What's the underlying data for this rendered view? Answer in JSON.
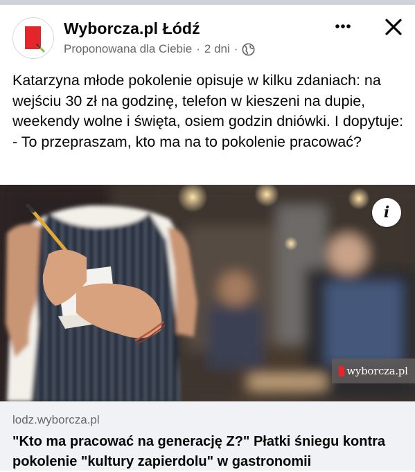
{
  "post": {
    "page_name": "Wyborcza.pl Łódź",
    "subtitle": "Proponowana dla Ciebie",
    "time": "2 dni",
    "separator": "·",
    "audience_icon": "globe-icon",
    "text": "Katarzyna młode pokolenie opisuje w kilku zdaniach:  na wejściu 30 zł na godzinę, telefon w kieszeni na dupie, weekendy wolne i święta, osiem godzin dniówki. I dopytuje: - To przepraszam, kto ma na to pokolenie pracować?"
  },
  "actions": {
    "more_icon": "more-options-icon",
    "close_icon": "close-icon"
  },
  "image": {
    "info_label": "i",
    "watermark": "wyborcza.pl"
  },
  "link": {
    "domain": "lodz.wyborcza.pl",
    "headline": "\"Kto ma pracować na generację Z?\" Płatki śniegu kontra pokolenie \"kultury zapierdolu\" w gastronomii"
  },
  "colors": {
    "brand_red": "#e4262c",
    "secondary_text": "#65676b",
    "link_bg": "#f0f2f5"
  }
}
